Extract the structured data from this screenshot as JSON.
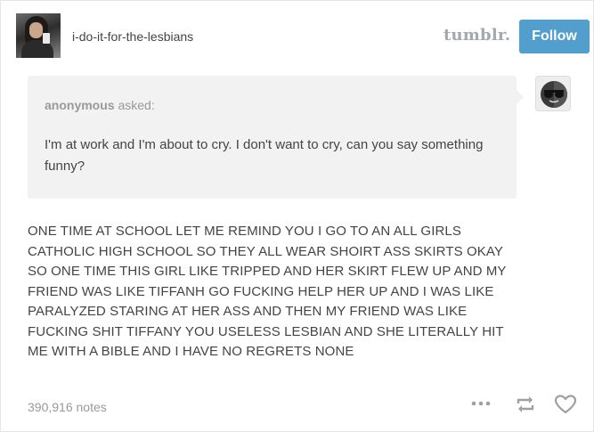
{
  "header": {
    "blog_name": "i-do-it-for-the-lesbians",
    "brand": "tumblr.",
    "follow_label": "Follow"
  },
  "ask": {
    "asker": "anonymous",
    "verb": "asked:",
    "question": "I'm at work and I'm about to cry. I don't want to cry, can you say something funny?"
  },
  "answer": {
    "lines": [
      "ONE TIME AT SCHOOL LET ME REMIND YOU I GO TO AN ALL GIRLS",
      "CATHOLIC HIGH SCHOOL SO THEY ALL WEAR SHOIRT ASS SKIRTS OKAY",
      "SO ONE TIME THIS GIRL LIKE TRIPPED AND HER SKIRT FLEW UP AND MY",
      "FRIEND WAS LIKE TIFFANH GO FUCKING HELP HER UP AND I WAS LIKE",
      "PARALYZED STARING AT HER ASS AND THEN MY FRIEND WAS LIKE",
      "FUCKING SHIT TIFFANY YOU USELESS LESBIAN AND SHE LITERALLY HIT",
      "ME WITH A BIBLE AND I HAVE NO REGRETS NONE"
    ]
  },
  "footer": {
    "notes": "390,916 notes",
    "icons": [
      "more-icon",
      "reblog-icon",
      "heart-icon"
    ]
  },
  "colors": {
    "follow_bg": "#529ecc",
    "ask_bg": "#f2f2f2",
    "muted_text": "#999999",
    "body_text": "#444444",
    "brand_gray": "#a2a8ae"
  }
}
